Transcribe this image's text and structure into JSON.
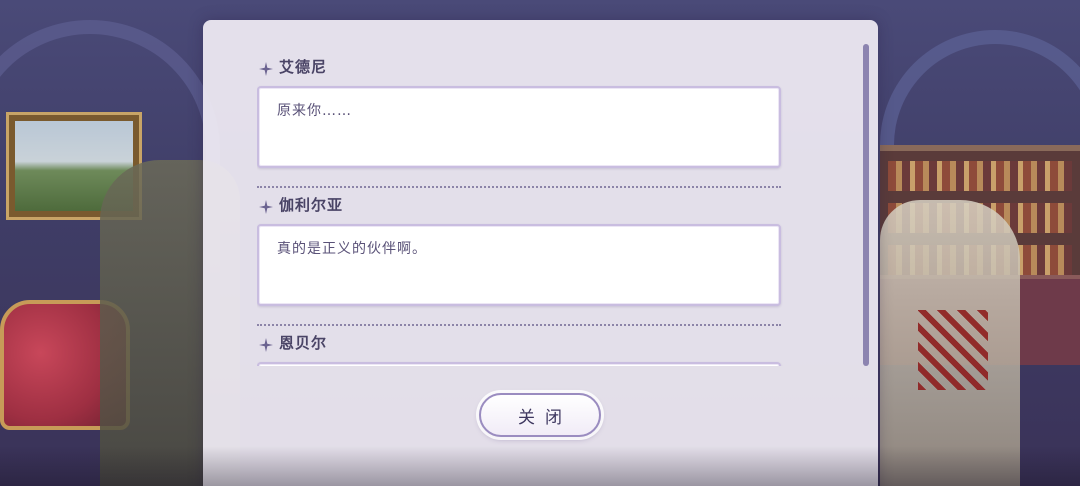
{
  "dialog_log": {
    "entries": [
      {
        "speaker": "艾德尼",
        "line": "原来你……"
      },
      {
        "speaker": "伽利尔亚",
        "line": "真的是正义的伙伴啊。"
      },
      {
        "speaker": "恩贝尔",
        "line": ""
      }
    ]
  },
  "close_button": {
    "label": "关闭"
  },
  "colors": {
    "panel": "#f0ecf4",
    "speaker_text": "#4a4466",
    "line_text": "#5a5278",
    "box_border": "#c9bde0",
    "scroll_thumb": "#8c84b0"
  },
  "icons": {
    "speaker_marker": "sparkle-icon"
  }
}
